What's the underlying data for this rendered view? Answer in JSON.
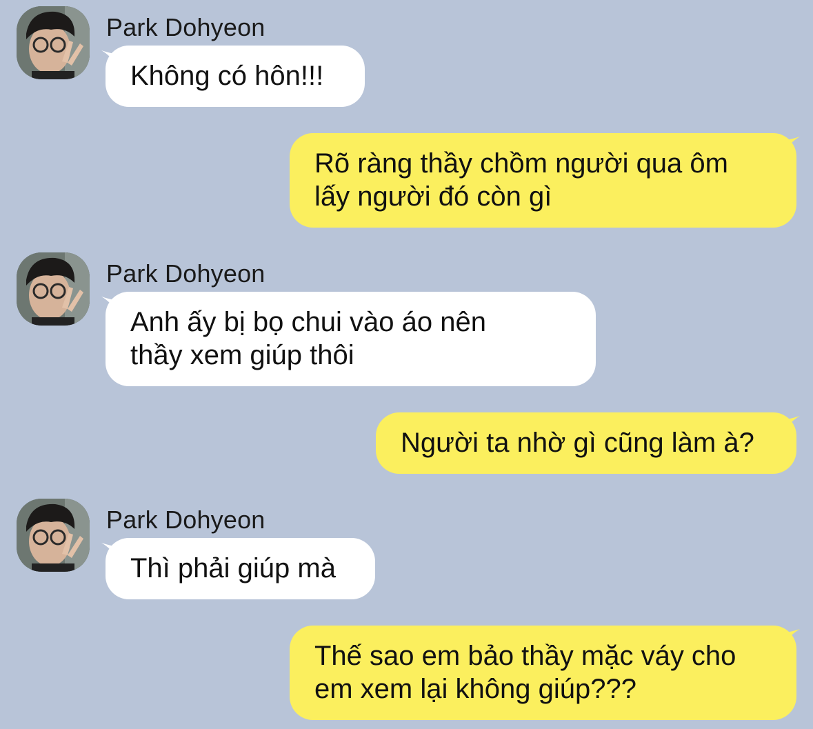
{
  "colors": {
    "background": "#b8c4d8",
    "incoming_bubble": "#ffffff",
    "outgoing_bubble": "#fbef5e",
    "text": "#111111"
  },
  "messages": [
    {
      "direction": "incoming",
      "sender": "Park Dohyeon",
      "avatar_icon": "user-avatar-photo",
      "lines": [
        "Không có hôn!!!"
      ]
    },
    {
      "direction": "outgoing",
      "lines": [
        "Rõ ràng thầy chồm người qua ôm",
        "lấy người đó còn gì"
      ]
    },
    {
      "direction": "incoming",
      "sender": "Park Dohyeon",
      "avatar_icon": "user-avatar-photo",
      "lines": [
        "Anh ấy bị bọ chui vào áo nên",
        "thầy xem giúp thôi"
      ]
    },
    {
      "direction": "outgoing",
      "lines": [
        "Người ta nhờ gì cũng làm à?"
      ]
    },
    {
      "direction": "incoming",
      "sender": "Park Dohyeon",
      "avatar_icon": "user-avatar-photo",
      "lines": [
        "Thì phải giúp mà"
      ]
    },
    {
      "direction": "outgoing",
      "lines": [
        "Thế sao em bảo thầy mặc váy cho",
        "em xem lại không giúp???"
      ]
    }
  ]
}
